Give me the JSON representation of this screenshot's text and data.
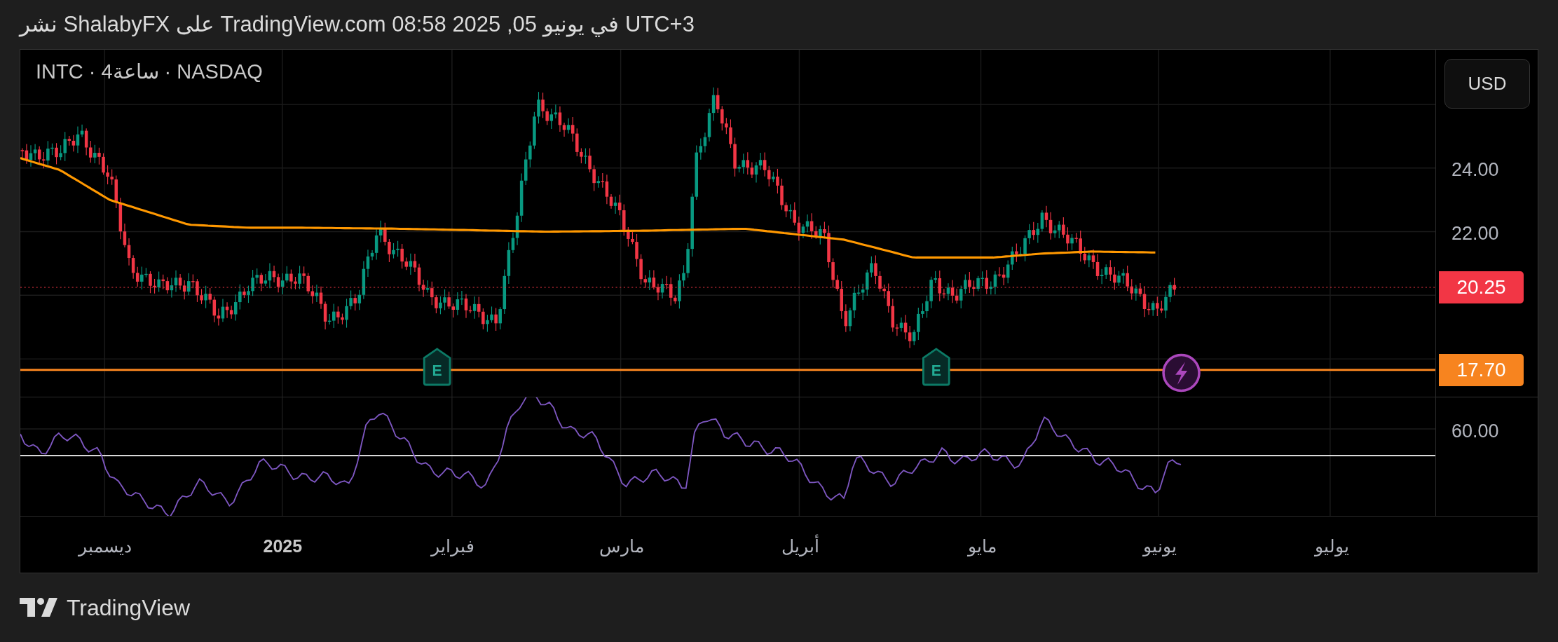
{
  "header": {
    "text": "نشر ShalabyFX على TradingView.com في يونيو 05, 2025 08:58 UTC+3"
  },
  "chart": {
    "symbol": "INTC · 4ساعة · NASDAQ",
    "currency_button": "USD",
    "price_axis": [
      "24.00",
      "22.00"
    ],
    "price_tags": [
      {
        "text": "20.25",
        "color": "#f23645"
      },
      {
        "text": "17.70",
        "color": "#f7841f"
      }
    ],
    "events": [
      {
        "kind": "lightning"
      },
      {
        "kind": "earnings",
        "label": "E"
      },
      {
        "kind": "earnings",
        "label": "E"
      }
    ],
    "rsi_axis": [
      "60.00"
    ],
    "time_axis": [
      {
        "text": "يوليو",
        "kind": "month"
      },
      {
        "text": "يونيو",
        "kind": "month"
      },
      {
        "text": "مايو",
        "kind": "month"
      },
      {
        "text": "أبريل",
        "kind": "month"
      },
      {
        "text": "مارس",
        "kind": "month"
      },
      {
        "text": "فبراير",
        "kind": "month"
      },
      {
        "text": "2025",
        "kind": "year"
      },
      {
        "text": "ديسمبر",
        "kind": "month"
      }
    ]
  },
  "footer": {
    "brand": "TradingView"
  }
}
